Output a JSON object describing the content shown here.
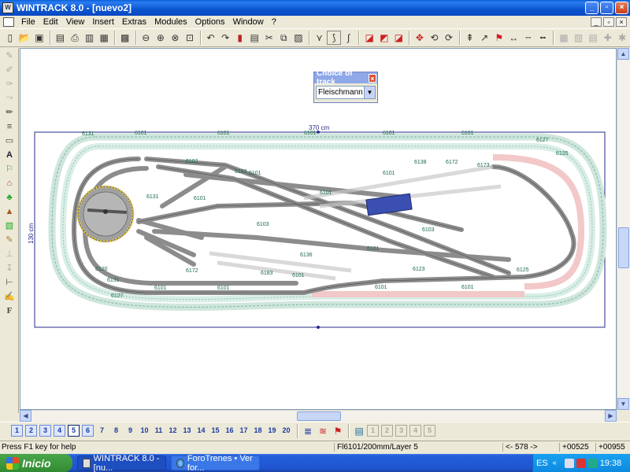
{
  "window": {
    "title": "WINTRACK 8.0 - [nuevo2]",
    "app_icon": "W"
  },
  "menu": [
    "File",
    "Edit",
    "View",
    "Insert",
    "Extras",
    "Modules",
    "Options",
    "Window",
    "?"
  ],
  "menu_controls": [
    "_",
    "▫",
    "×"
  ],
  "canvas": {
    "width_label": "370 cm",
    "height_label": "130 cm",
    "track_labels": [
      "6101",
      "6131",
      "6127",
      "6125",
      "6103",
      "6102",
      "6172",
      "6173",
      "6120",
      "6138",
      "6133",
      "6123",
      "6183",
      "6136"
    ]
  },
  "choice_dialog": {
    "title": "Choice of track",
    "value": "Fleischmann Pi"
  },
  "layers": [
    "1",
    "2",
    "3",
    "4",
    "5",
    "6",
    "7",
    "8",
    "9",
    "10",
    "11",
    "12",
    "13",
    "14",
    "15",
    "16",
    "17",
    "18",
    "19",
    "20"
  ],
  "layer_extra": [
    "1",
    "2",
    "3",
    "4",
    "5"
  ],
  "status": {
    "help": "Press F1 key for help",
    "info": "Fl6101/200mm/Layer 5",
    "scale": "<- 578 ->",
    "x": "+00525",
    "y": "+00955"
  },
  "taskbar": {
    "start": "Inicio",
    "tasks": [
      "WINTRACK 8.0 - [nu...",
      "ForoTrenes • Ver for..."
    ],
    "lang": "ES",
    "clock": "19:38"
  }
}
